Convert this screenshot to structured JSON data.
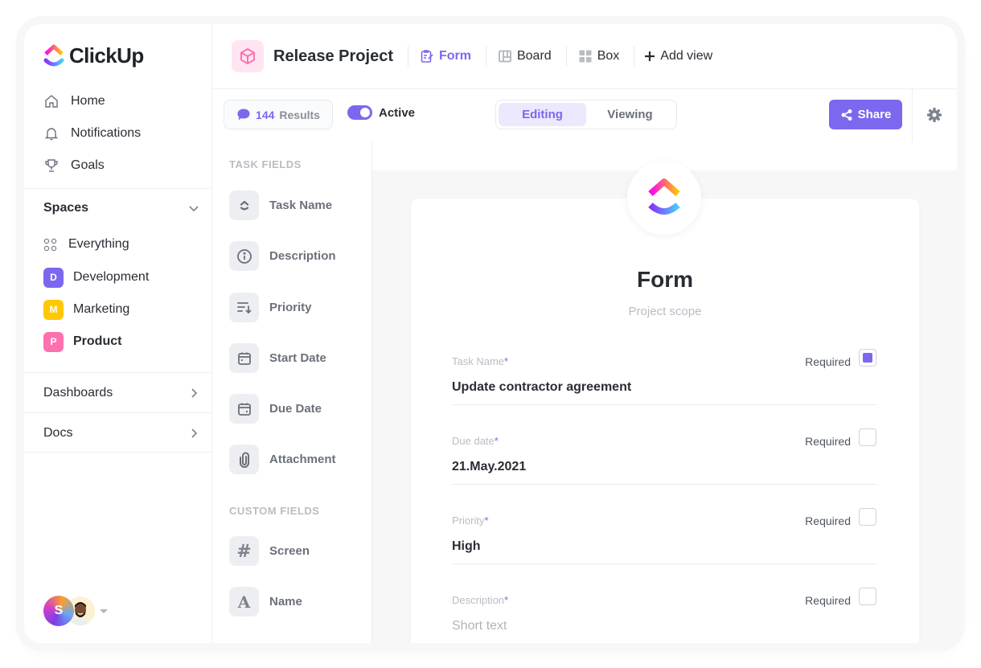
{
  "app": {
    "brand": "ClickUp",
    "accent_color": "#7b68ee"
  },
  "sidebar": {
    "nav": [
      {
        "label": "Home",
        "icon": "home-icon"
      },
      {
        "label": "Notifications",
        "icon": "bell-icon"
      },
      {
        "label": "Goals",
        "icon": "trophy-icon"
      }
    ],
    "spaces": {
      "title": "Spaces",
      "items": [
        {
          "label": "Everything",
          "icon": "grid-dots-icon"
        },
        {
          "label": "Development",
          "badge": "D",
          "color": "#7b68ee"
        },
        {
          "label": "Marketing",
          "badge": "M",
          "color": "#ffc800"
        },
        {
          "label": "Product",
          "badge": "P",
          "color": "#fd71af",
          "active": true
        }
      ]
    },
    "dashboards": "Dashboards",
    "docs": "Docs",
    "user_avatar_initial": "S"
  },
  "header": {
    "project_title": "Release Project",
    "views": [
      {
        "label": "Form",
        "icon": "form-icon",
        "active": true
      },
      {
        "label": "Board",
        "icon": "board-icon"
      },
      {
        "label": "Box",
        "icon": "box-icon"
      }
    ],
    "add_view": "Add view"
  },
  "toolbar": {
    "results_count": "144",
    "results_label": "Results",
    "active_label": "Active",
    "active_on": true,
    "modes": [
      {
        "label": "Editing",
        "selected": true
      },
      {
        "label": "Viewing",
        "selected": false
      }
    ],
    "share_label": "Share"
  },
  "fields_panel": {
    "task_fields_title": "TASK FIELDS",
    "task_fields": [
      {
        "label": "Task Name",
        "icon": "task-name-icon"
      },
      {
        "label": "Description",
        "icon": "info-icon"
      },
      {
        "label": "Priority",
        "icon": "priority-sort-icon"
      },
      {
        "label": "Start Date",
        "icon": "calendar-start-icon"
      },
      {
        "label": "Due Date",
        "icon": "calendar-due-icon"
      },
      {
        "label": "Attachment",
        "icon": "paperclip-icon"
      }
    ],
    "custom_fields_title": "CUSTOM FIELDS",
    "custom_fields": [
      {
        "label": "Screen",
        "icon": "hash-icon",
        "glyph": "#"
      },
      {
        "label": "Name",
        "icon": "text-icon",
        "glyph": "A"
      }
    ]
  },
  "form": {
    "title": "Form",
    "subtitle": "Project scope",
    "required_label": "Required",
    "questions": [
      {
        "label": "Task Name",
        "value": "Update contractor agreement",
        "required": true,
        "placeholder": false
      },
      {
        "label": "Due date",
        "value": "21.May.2021",
        "required": false,
        "placeholder": false
      },
      {
        "label": "Priority",
        "value": "High",
        "required": false,
        "placeholder": false
      },
      {
        "label": "Description",
        "value": "Short text",
        "required": false,
        "placeholder": true
      }
    ]
  }
}
